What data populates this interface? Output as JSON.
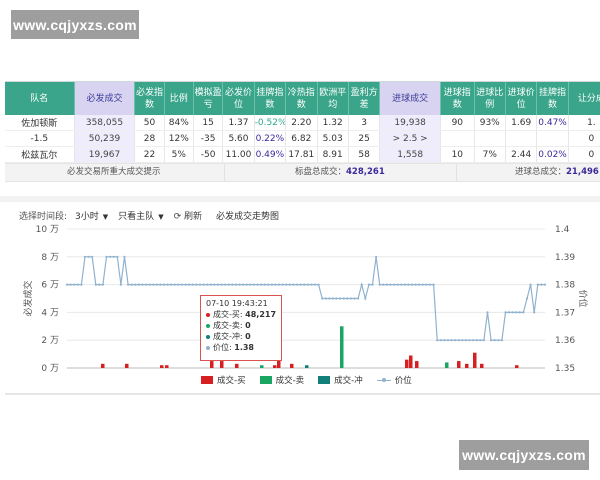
{
  "watermarks": {
    "top": "www.cqjyxzs.com",
    "bottom": "www.cqjyxzs.com"
  },
  "table": {
    "headers": [
      "队名",
      "必发成交",
      "必发指数",
      "比例",
      "模拟盈亏",
      "必发价位",
      "挂牌指数",
      "冷热指数",
      "欧洲平均",
      "盈利方差",
      "进球成交",
      "进球指数",
      "进球比例",
      "进球价位",
      "挂牌指数",
      "让分成"
    ],
    "rows": [
      [
        "佐加顿斯",
        "358,055",
        "50",
        "84%",
        "15",
        "1.37",
        "-0.52%",
        "2.20",
        "1.32",
        "3",
        "19,938",
        "90",
        "93%",
        "1.69",
        "0.47%",
        "1."
      ],
      [
        "-1.5",
        "50,239",
        "28",
        "12%",
        "-35",
        "5.60",
        "0.22%",
        "6.82",
        "5.03",
        "25",
        "> 2.5 >",
        "",
        "",
        "",
        "",
        "0"
      ],
      [
        "松兹瓦尔",
        "19,967",
        "22",
        "5%",
        "-50",
        "11.00",
        "0.49%",
        "17.81",
        "8.91",
        "58",
        "1,558",
        "10",
        "7%",
        "2.44",
        "0.02%",
        "0"
      ]
    ],
    "summary": {
      "hint": "必发交易所重大成交提示",
      "total_label": "标盘总成交：",
      "total_value": "428,261",
      "goal_label": "进球总成交：",
      "goal_value": "21,496"
    }
  },
  "toolbar": {
    "time_label": "选择时间段:",
    "time_value": "3小时",
    "team_value": "只看主队",
    "refresh_label": "刷新",
    "chart_title": "必发成交走势图"
  },
  "tooltip": {
    "time": "07-10 19:43:21",
    "buy_label": "成交-买:",
    "buy_value": "48,217",
    "sell_label": "成交-卖:",
    "sell_value": "0",
    "hedge_label": "成交-冲:",
    "hedge_value": "0",
    "price_label": "价位:",
    "price_value": "1.38"
  },
  "colors": {
    "buy": "#d71e20",
    "sell": "#1aa563",
    "hedge": "#137f7b",
    "price": "#8fb2cf",
    "header": "#3aa58a"
  },
  "chart_data": {
    "type": "bar",
    "yleft_label": "必发成交",
    "yright_label": "价位",
    "yleft_ticks": [
      "0 万",
      "2 万",
      "4 万",
      "6 万",
      "8 万",
      "10 万"
    ],
    "yright_ticks": [
      "1.35",
      "1.36",
      "1.37",
      "1.38",
      "1.39",
      "1.4"
    ],
    "ylim_left": [
      0,
      100000
    ],
    "ylim_right": [
      1.35,
      1.4
    ],
    "series": [
      {
        "name": "成交-买",
        "values": [
          48217,
          3000,
          3000,
          2000,
          2000,
          5000,
          5000,
          3000,
          2000,
          3000,
          6000,
          5000,
          3000,
          3000,
          3000,
          9000,
          5000,
          11000,
          2000
        ]
      },
      {
        "name": "成交-卖",
        "values": [
          2000,
          30000,
          4000
        ]
      },
      {
        "name": "成交-冲",
        "values": [
          2000
        ]
      },
      {
        "name": "价位",
        "values": [
          1.38,
          1.38,
          1.38,
          1.38,
          1.38,
          1.39,
          1.39,
          1.39,
          1.38,
          1.38,
          1.38,
          1.39,
          1.39,
          1.39,
          1.39,
          1.38,
          1.39,
          1.38,
          1.38,
          1.38,
          1.38,
          1.38,
          1.38,
          1.38,
          1.38,
          1.38,
          1.38,
          1.38,
          1.38,
          1.38,
          1.38,
          1.38,
          1.38,
          1.38,
          1.38,
          1.38,
          1.38,
          1.38,
          1.38,
          1.38,
          1.38,
          1.38,
          1.38,
          1.38,
          1.38,
          1.38,
          1.38,
          1.38,
          1.38,
          1.38,
          1.38,
          1.38,
          1.38,
          1.38,
          1.38,
          1.38,
          1.38,
          1.38,
          1.38,
          1.38,
          1.38,
          1.38,
          1.38,
          1.38,
          1.38,
          1.38,
          1.38,
          1.38,
          1.38,
          1.38,
          1.38,
          1.375,
          1.375,
          1.375,
          1.375,
          1.375,
          1.375,
          1.375,
          1.375,
          1.375,
          1.375,
          1.375,
          1.38,
          1.375,
          1.38,
          1.38,
          1.39,
          1.38,
          1.38,
          1.38,
          1.38,
          1.38,
          1.38,
          1.38,
          1.38,
          1.38,
          1.38,
          1.38,
          1.38,
          1.38,
          1.38,
          1.38,
          1.38,
          1.36,
          1.36,
          1.36,
          1.36,
          1.36,
          1.36,
          1.36,
          1.36,
          1.36,
          1.36,
          1.36,
          1.36,
          1.36,
          1.36,
          1.37,
          1.36,
          1.36,
          1.36,
          1.36,
          1.37,
          1.37,
          1.37,
          1.37,
          1.37,
          1.37,
          1.375,
          1.38,
          1.37,
          1.38,
          1.38,
          1.38
        ]
      }
    ],
    "legend": [
      "成交-买",
      "成交-卖",
      "成交-冲",
      "价位"
    ]
  }
}
